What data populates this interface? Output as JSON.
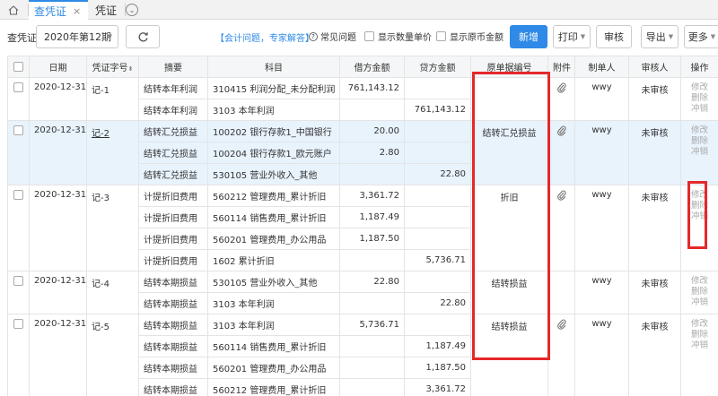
{
  "tabs": {
    "home_icon": "home-icon",
    "items": [
      {
        "label": "查凭证",
        "close": "×"
      },
      {
        "label": "凭证"
      }
    ],
    "more": "⊙"
  },
  "toolbar": {
    "label": "查凭证",
    "period": "2020年第12期",
    "consult": "【会计问题，专家解答】",
    "faq": "常见问题",
    "show_qty": "显示数量单价",
    "show_fc": "显示原币金额",
    "new": "新增",
    "print": "打印",
    "audit": "审核",
    "export": "导出",
    "more": "更多"
  },
  "table": {
    "headers": [
      "",
      "日期",
      "凭证字号",
      "摘要",
      "科目",
      "借方金额",
      "贷方金额",
      "原单据编号",
      "附件",
      "制单人",
      "审核人",
      "操作"
    ],
    "ops": [
      "修改",
      "删除",
      "冲销"
    ],
    "vouchers": [
      {
        "date": "2020-12-31",
        "no": "记-1",
        "doc": "",
        "attach": true,
        "maker": "wwy",
        "auditor": "未审核",
        "highlight": false,
        "underline": false,
        "lines": [
          {
            "summary": "结转本年利润",
            "account": "310415 利润分配_未分配利润",
            "debit": "761,143.12",
            "credit": ""
          },
          {
            "summary": "结转本年利润",
            "account": "3103 本年利润",
            "debit": "",
            "credit": "761,143.12"
          }
        ]
      },
      {
        "date": "2020-12-31",
        "no": "记-2",
        "doc": "结转汇兑损益",
        "attach": true,
        "maker": "wwy",
        "auditor": "未审核",
        "highlight": true,
        "underline": true,
        "lines": [
          {
            "summary": "结转汇兑损益",
            "account": "100202 银行存款1_中国银行",
            "debit": "20.00",
            "credit": ""
          },
          {
            "summary": "结转汇兑损益",
            "account": "100204 银行存款1_欧元账户",
            "debit": "2.80",
            "credit": ""
          },
          {
            "summary": "结转汇兑损益",
            "account": "530105 营业外收入_其他",
            "debit": "",
            "credit": "22.80"
          }
        ]
      },
      {
        "date": "2020-12-31",
        "no": "记-3",
        "doc": "折旧",
        "attach": true,
        "maker": "wwy",
        "auditor": "未审核",
        "highlight": false,
        "underline": false,
        "lines": [
          {
            "summary": "计提折旧费用",
            "account": "560212 管理费用_累计折旧",
            "debit": "3,361.72",
            "credit": ""
          },
          {
            "summary": "计提折旧费用",
            "account": "560114 销售费用_累计折旧",
            "debit": "1,187.49",
            "credit": ""
          },
          {
            "summary": "计提折旧费用",
            "account": "560201 管理费用_办公用品",
            "debit": "1,187.50",
            "credit": ""
          },
          {
            "summary": "计提折旧费用",
            "account": "1602 累计折旧",
            "debit": "",
            "credit": "5,736.71"
          }
        ]
      },
      {
        "date": "2020-12-31",
        "no": "记-4",
        "doc": "结转损益",
        "attach": false,
        "maker": "wwy",
        "auditor": "未审核",
        "highlight": false,
        "underline": false,
        "lines": [
          {
            "summary": "结转本期损益",
            "account": "530105 营业外收入_其他",
            "debit": "22.80",
            "credit": ""
          },
          {
            "summary": "结转本期损益",
            "account": "3103 本年利润",
            "debit": "",
            "credit": "22.80"
          }
        ]
      },
      {
        "date": "2020-12-31",
        "no": "记-5",
        "doc": "结转损益",
        "attach": true,
        "maker": "wwy",
        "auditor": "未审核",
        "highlight": false,
        "underline": false,
        "lines": [
          {
            "summary": "结转本期损益",
            "account": "3103 本年利润",
            "debit": "5,736.71",
            "credit": ""
          },
          {
            "summary": "结转本期损益",
            "account": "560114 销售费用_累计折旧",
            "debit": "",
            "credit": "1,187.49"
          },
          {
            "summary": "结转本期损益",
            "account": "560201 管理费用_办公用品",
            "debit": "",
            "credit": "1,187.50"
          },
          {
            "summary": "结转本期损益",
            "account": "560212 管理费用_累计折旧",
            "debit": "",
            "credit": "3,361.72"
          }
        ]
      }
    ]
  },
  "colors": {
    "accent": "#2e8ae6",
    "annotation": "#e5282a",
    "highlight_row": "#e8f3fc"
  }
}
